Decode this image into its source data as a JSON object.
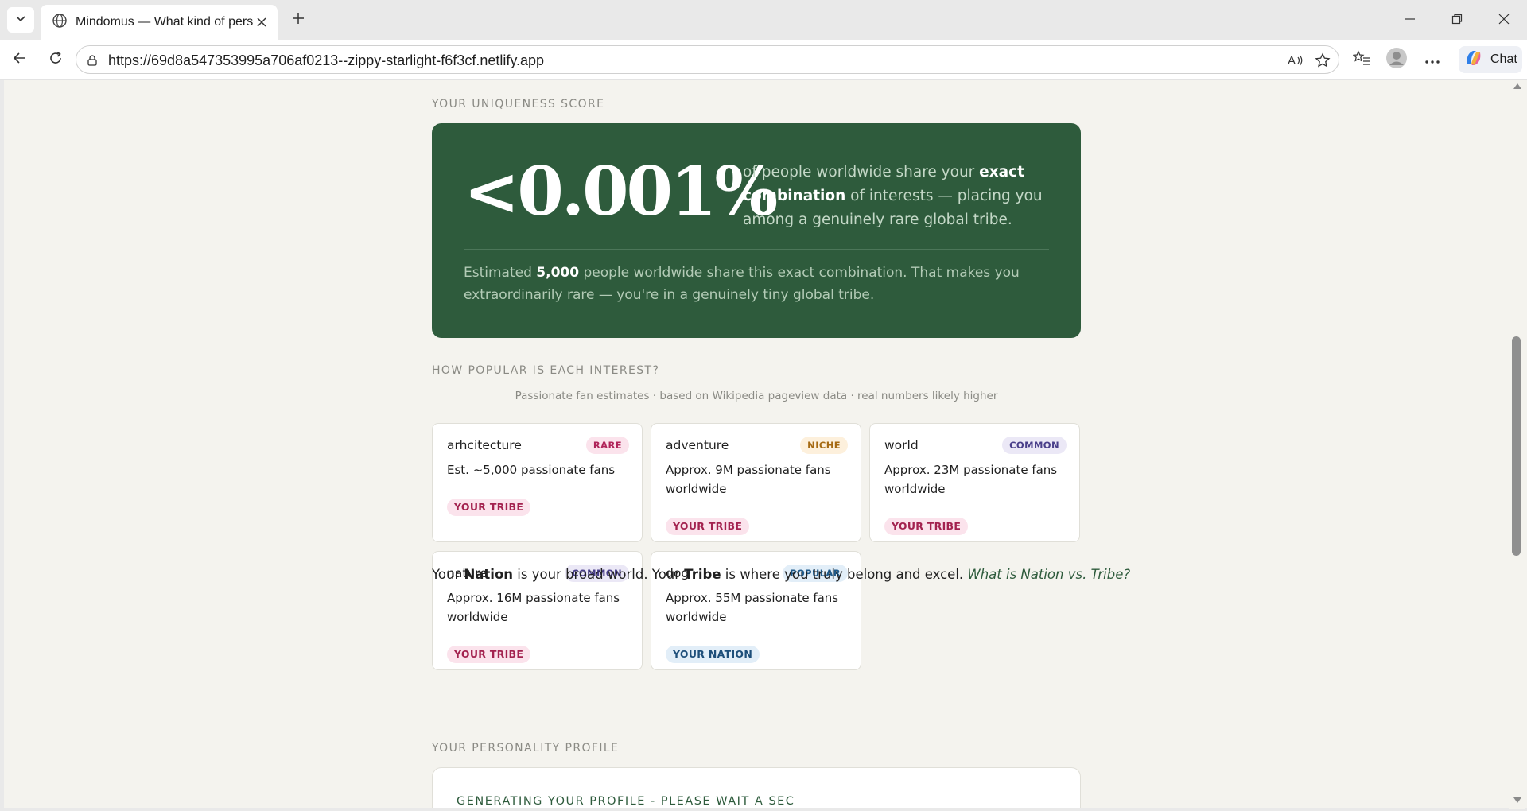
{
  "browser": {
    "tab_title": "Mindomus — What kind of person are you?",
    "url": "https://69d8a547353995a706af0213--zippy-starlight-f6f3cf.netlify.app",
    "chat_label": "Chat"
  },
  "colors": {
    "brand_green": "#2e5b3c",
    "page_bg": "#f4f3ee",
    "rare": "#b0245a",
    "niche": "#a66a12",
    "common": "#4a3f8a",
    "popular": "#1f5a8a"
  },
  "uniqueness": {
    "section_label": "YOUR UNIQUENESS SCORE",
    "score": "<0.001%",
    "desc_part1": "of people worldwide share your ",
    "desc_bold": "exact combination",
    "desc_part2": " of interests — placing you among a genuinely rare global tribe.",
    "estimate_prefix": "Estimated ",
    "estimate_count": "5,000",
    "estimate_suffix": " people worldwide share this exact combination. That makes you extraordinarily rare — you're in a genuinely tiny global tribe."
  },
  "popularity": {
    "section_label": "HOW POPULAR IS EACH INTEREST?",
    "note": "Passionate fan estimates · based on Wikipedia pageview data · real numbers likely higher",
    "interests": [
      {
        "name": "arhcitecture",
        "badge": "RARE",
        "badge_type": "rare",
        "fans": "Est. ~5,000 passionate fans",
        "group": "YOUR TRIBE",
        "group_type": "tribe"
      },
      {
        "name": "adventure",
        "badge": "NICHE",
        "badge_type": "niche",
        "fans": "Approx. 9M passionate fans worldwide",
        "group": "YOUR TRIBE",
        "group_type": "tribe"
      },
      {
        "name": "world",
        "badge": "COMMON",
        "badge_type": "common",
        "fans": "Approx. 23M passionate fans worldwide",
        "group": "YOUR TRIBE",
        "group_type": "tribe"
      },
      {
        "name": "nature",
        "badge": "COMMON",
        "badge_type": "common",
        "fans": "Approx. 16M passionate fans worldwide",
        "group": "YOUR TRIBE",
        "group_type": "tribe"
      },
      {
        "name": "dog",
        "badge": "POPULAR",
        "badge_type": "popular",
        "fans": "Approx. 55M passionate fans worldwide",
        "group": "YOUR NATION",
        "group_type": "nation"
      }
    ]
  },
  "nation_line": {
    "p1": "Your ",
    "nation": "Nation",
    "p2": " is your broad world. Your ",
    "tribe": "Tribe",
    "p3": " is where you truly belong and excel. ",
    "link": "What is Nation vs. Tribe?"
  },
  "profile": {
    "section_label": "YOUR PERSONALITY PROFILE",
    "status": "GENERATING YOUR PROFILE - PLEASE WAIT A SEC"
  }
}
